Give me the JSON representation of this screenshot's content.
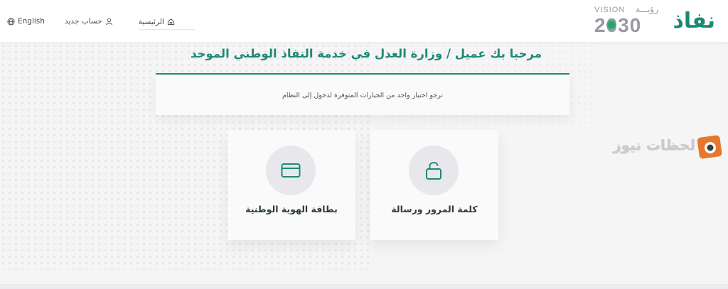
{
  "header": {
    "brand": "نفاذ",
    "vision_label": "VISION",
    "vision_ar": "رؤيـــة",
    "vision_year": "2030",
    "nav": {
      "language": "English",
      "signup": "حساب جديد",
      "home": "الرئيسية"
    }
  },
  "main": {
    "title": "مرحبا بك عميل / وزارة العدل في خدمة النفاذ الوطني الموحد",
    "instruction": "نرجو اختيار واحد من الخيارات المتوفرة لدخول إلى النظام",
    "options": [
      {
        "label": "بطاقة الهوية الوطنية",
        "icon": "id-card-icon"
      },
      {
        "label": "كلمة المرور ورسالة",
        "icon": "unlock-icon"
      }
    ]
  },
  "watermark": {
    "text": "لحظات نيوز"
  },
  "colors": {
    "accent": "#1f8a74",
    "card_bg": "#fafafa",
    "page_bg": "#f5f5f6",
    "icon_circle": "#e8e8ec",
    "watermark_orange": "#e8772e"
  }
}
